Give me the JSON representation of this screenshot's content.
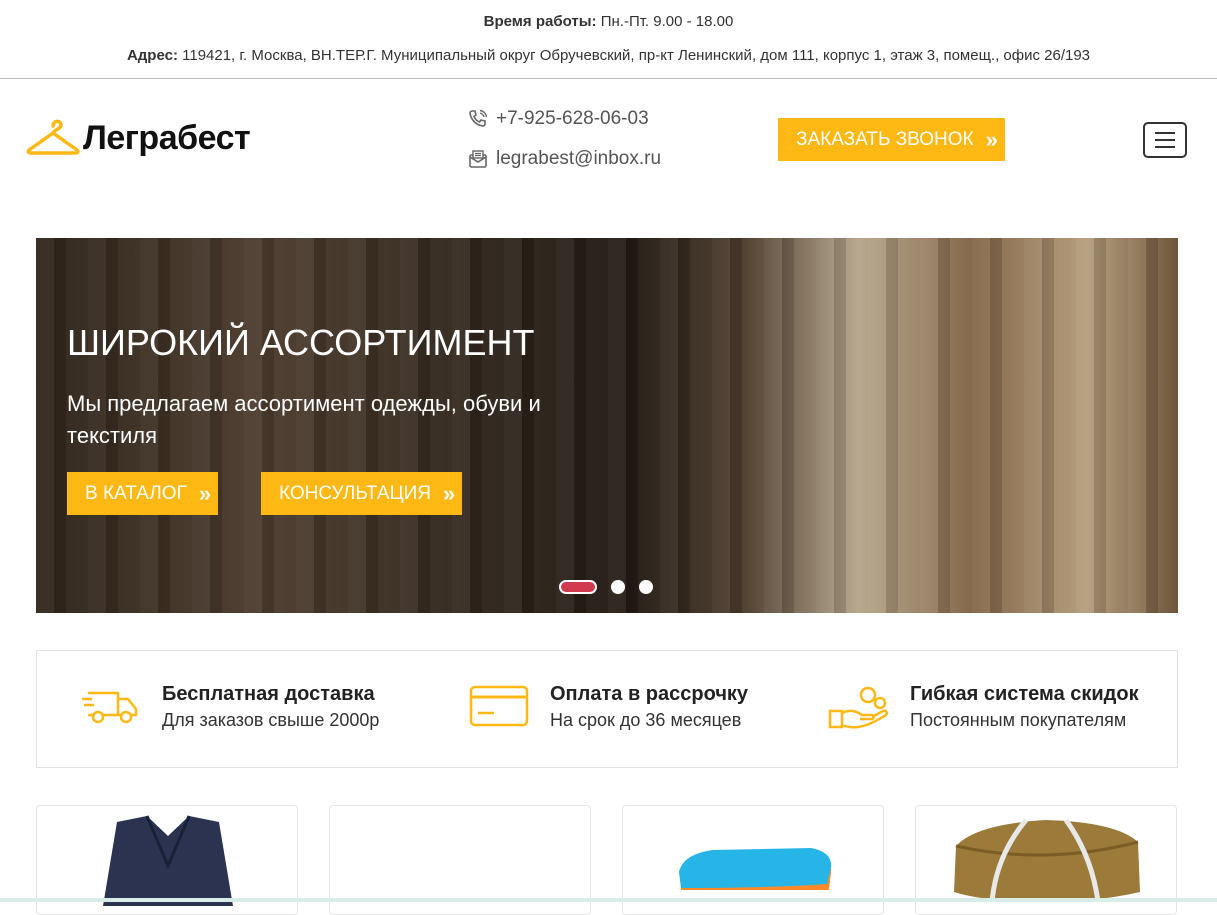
{
  "topbar": {
    "hours_label": "Время работы:",
    "hours_value": " Пн.-Пт. 9.00 - 18.00",
    "address_label": "Адрес:",
    "address_value": " 119421, г. Москва, ВН.ТЕР.Г. Муниципальный округ Обручевский, пр-кт Ленинский, дом 111, корпус 1, этаж 3, помещ., офис 26/193"
  },
  "header": {
    "logo_text": "Леграбест",
    "phone": "+7-925-628-06-03",
    "email": "legrabest@inbox.ru",
    "order_button": "ЗАКАЗАТЬ ЗВОНОК",
    "accent_color": "#fdb814"
  },
  "hero": {
    "title": "ШИРОКИЙ АССОРТИМЕНТ",
    "text": "Мы предлагаем ассортимент одежды, обуви и текстиля",
    "catalog_button": "В КАТАЛОГ",
    "consult_button": "КОНСУЛЬТАЦИЯ",
    "slides_total": 3,
    "active_slide": 1
  },
  "features": [
    {
      "icon": "delivery-truck-icon",
      "title": "Бесплатная доставка",
      "subtitle": "Для заказов свыше 2000р"
    },
    {
      "icon": "credit-card-icon",
      "title": "Оплата в рассрочку",
      "subtitle": "На срок до 36 месяцев"
    },
    {
      "icon": "discount-hand-icon",
      "title": "Гибкая система скидок",
      "subtitle": "Постоянным покупателям"
    }
  ],
  "cards": [
    "jacket-image",
    "empty-image",
    "towels-image",
    "blanket-image"
  ]
}
